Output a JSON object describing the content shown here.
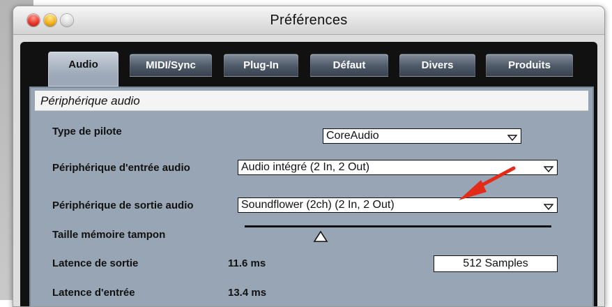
{
  "window": {
    "title": "Préférences"
  },
  "tabs": [
    {
      "label": "Audio",
      "active": true
    },
    {
      "label": "MIDI/Sync",
      "active": false
    },
    {
      "label": "Plug-In",
      "active": false
    },
    {
      "label": "Défaut",
      "active": false
    },
    {
      "label": "Divers",
      "active": false
    },
    {
      "label": "Produits",
      "active": false
    }
  ],
  "section": {
    "title": "Périphérique audio"
  },
  "fields": {
    "driver_type": {
      "label": "Type de pilote",
      "value": "CoreAudio"
    },
    "input_device": {
      "label": "Périphérique d'entrée audio",
      "value": "Audio intégré (2 In, 2 Out)"
    },
    "output_device": {
      "label": "Périphérique de sortie audio",
      "value": "Soundflower (2ch) (2 In, 2 Out)"
    },
    "buffer_size": {
      "label": "Taille mémoire tampon",
      "value": "512 Samples"
    },
    "output_latency": {
      "label": "Latence de sortie",
      "value": "11.6 ms"
    },
    "input_latency": {
      "label": "Latence d'entrée",
      "value": "13.4 ms"
    }
  },
  "colors": {
    "tab_active": "#9ca8b7",
    "tab_inactive": "#4e5968",
    "panel": "#98a5b4",
    "annotation": "#e22b18"
  },
  "icons": {
    "traffic_lights": [
      "close-icon",
      "minimize-icon",
      "zoom-icon"
    ],
    "dropdown": "chevron-down-icon",
    "slider_thumb": "triangle-icon",
    "annotation": "red-arrow-icon"
  }
}
